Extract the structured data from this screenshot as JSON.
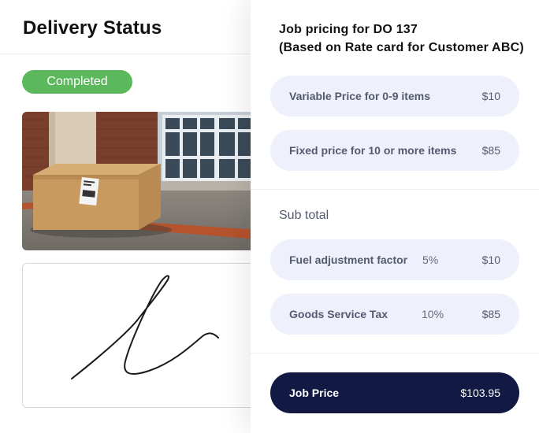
{
  "delivery": {
    "title": "Delivery Status",
    "status_badge": "Completed",
    "status_color": "#5cb85c"
  },
  "pricing": {
    "title_line1": "Job pricing for DO 137",
    "title_line2": "(Based on Rate card for Customer ABC)",
    "items": [
      {
        "label": "Variable Price for 0-9 items",
        "amount": "$10"
      },
      {
        "label": "Fixed price for 10 or more items",
        "amount": "$85"
      }
    ],
    "subtotal_label": "Sub total",
    "adjustments": [
      {
        "label": "Fuel adjustment factor",
        "percent": "5%",
        "amount": "$10"
      },
      {
        "label": "Goods Service Tax",
        "percent": "10%",
        "amount": "$85"
      }
    ],
    "total": {
      "label": "Job Price",
      "amount": "$103.95"
    },
    "accent_color": "#121a43",
    "pill_color": "#eef0fb"
  }
}
